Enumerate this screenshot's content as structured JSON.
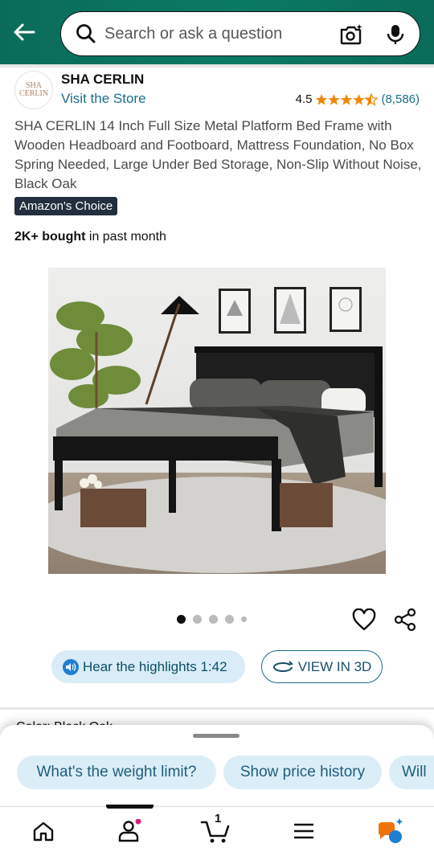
{
  "header": {
    "search_placeholder": "Search or ask a question"
  },
  "brand": {
    "logo_text_line1": "SHA",
    "logo_text_line2": "CERLIN",
    "name": "SHA CERLIN",
    "visit_store": "Visit the Store"
  },
  "rating": {
    "value": "4.5",
    "stars": 4.5,
    "count": "(8,586)"
  },
  "product": {
    "title": "SHA CERLIN 14 Inch Full Size Metal Platform Bed Frame with Wooden Headboard and Footboard, Mattress Foundation, No Box Spring Needed, Large Under Bed Storage, Non-Slip Without Noise, Black Oak",
    "badge": "Amazon's Choice",
    "bought_bold": "2K+ bought",
    "bought_rest": " in past month"
  },
  "gallery": {
    "total_dots": 5,
    "active_index": 0
  },
  "actions": {
    "hear_label": "Hear the highlights 1:42",
    "view3d_label": "VIEW IN 3D"
  },
  "peek_text": "Color: Black Oak",
  "suggestions": [
    "What's the weight limit?",
    "Show price history",
    "Will"
  ],
  "bottom_nav": {
    "cart_count": "1"
  },
  "colors": {
    "header": "#0b7a63",
    "link": "#1a6e8a",
    "star": "#f08804",
    "chip_bg": "#dbeef8",
    "badge_bg": "#232f3e"
  }
}
